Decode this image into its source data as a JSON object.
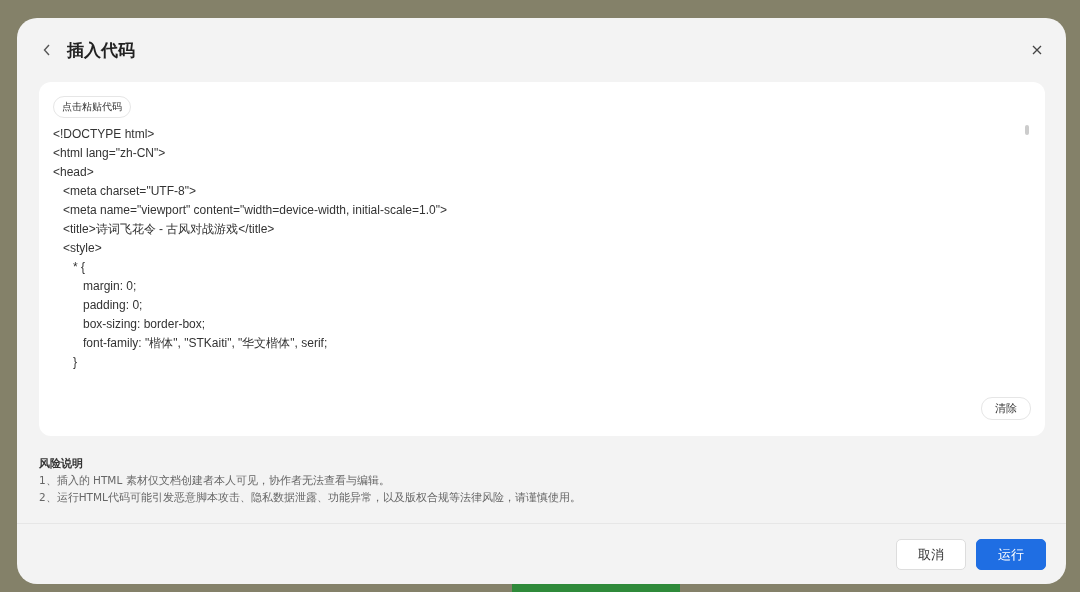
{
  "dialog": {
    "title": "插入代码"
  },
  "editor": {
    "paste_button": "点击粘贴代码",
    "code_lines": [
      "<!DOCTYPE html>",
      "<html lang=\"zh-CN\">",
      "<head>",
      "   <meta charset=\"UTF-8\">",
      "   <meta name=\"viewport\" content=\"width=device-width, initial-scale=1.0\">",
      "   <title>诗词飞花令 - 古风对战游戏</title>",
      "   <style>",
      "      * {",
      "         margin: 0;",
      "         padding: 0;",
      "         box-sizing: border-box;",
      "         font-family: \"楷体\", \"STKaiti\", \"华文楷体\", serif;",
      "      }"
    ],
    "clear_button": "清除"
  },
  "risk": {
    "title": "风险说明",
    "items": [
      "1、插入的 HTML 素材仅文档创建者本人可见，协作者无法查看与编辑。",
      "2、运行HTML代码可能引发恶意脚本攻击、隐私数据泄露、功能异常，以及版权合规等法律风险，请谨慎使用。"
    ]
  },
  "buttons": [
    {
      "label": "取消",
      "kind": "secondary"
    },
    {
      "label": "运行",
      "kind": "primary"
    }
  ]
}
